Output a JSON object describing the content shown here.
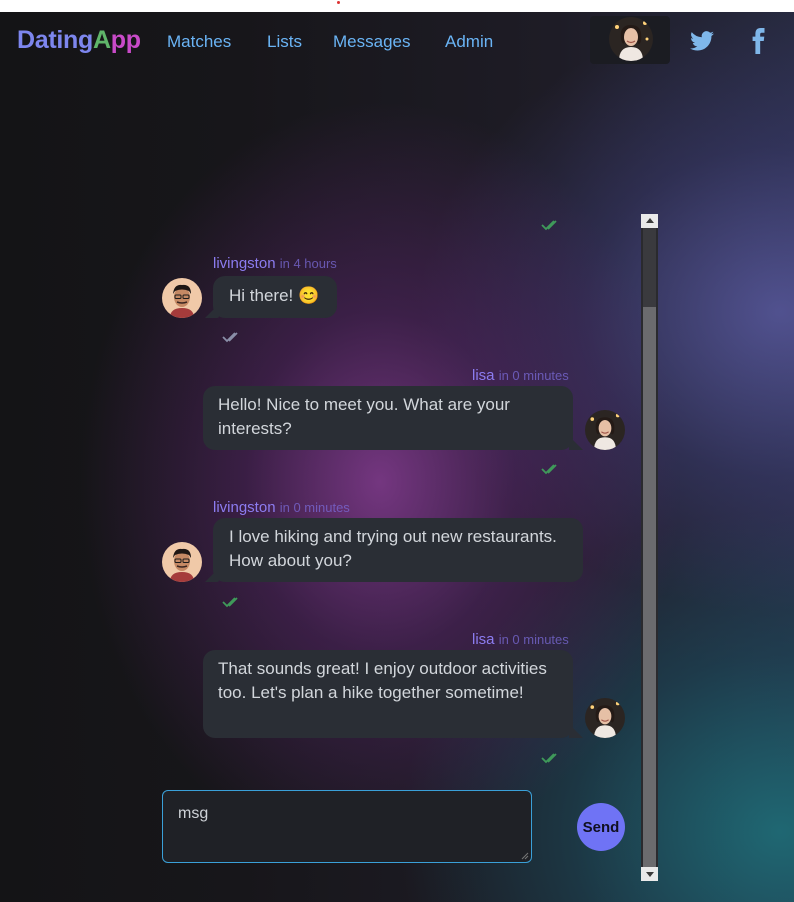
{
  "navbar": {
    "brand": {
      "part1": "Dating",
      "part2": "A",
      "part3": "pp"
    },
    "links": [
      "Matches",
      "Lists",
      "Messages",
      "Admin"
    ],
    "avatar_icon": "user-avatar-lisa",
    "social": [
      "twitter-icon",
      "facebook-icon"
    ]
  },
  "messages": [
    {
      "sender": "livingston",
      "time": "in 4 hours",
      "text": "Hi there! 😊",
      "side": "left"
    },
    {
      "sender": "lisa",
      "time": "in 0 minutes",
      "text": "Hello! Nice to meet you. What are your interests?",
      "side": "right"
    },
    {
      "sender": "livingston",
      "time": "in 0 minutes",
      "text": "I love hiking and trying out new restaurants. How about you?",
      "side": "left"
    },
    {
      "sender": "lisa",
      "time": "in 0 minutes",
      "text": "That sounds great! I enjoy outdoor activities too. Let's plan a hike together sometime!",
      "side": "right"
    }
  ],
  "composer": {
    "value": "msg",
    "send_label": "Send"
  },
  "colors": {
    "brand_blue": "#7d86ee",
    "brand_green": "#5fb56a",
    "brand_pink": "#c94ac8",
    "nav_link": "#6ab4f5",
    "sender": "#8c7cf0",
    "bubble": "#2a2e35",
    "send_button": "#6f73f5",
    "read_check": "#3f9a5a"
  }
}
